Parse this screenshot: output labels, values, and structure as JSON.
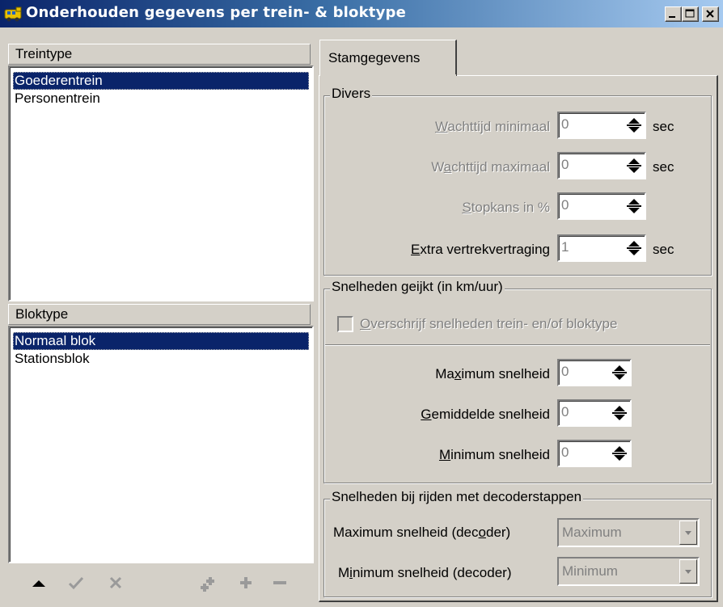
{
  "window": {
    "title": "Onderhouden gegevens per trein- & bloktype",
    "icon": "train-icon",
    "controls": [
      "minimize",
      "maximize",
      "close"
    ]
  },
  "treintype": {
    "header": "Treintype",
    "items": [
      "Goederentrein",
      "Personentrein"
    ],
    "selected": "Goederentrein"
  },
  "bloktype": {
    "header": "Bloktype",
    "items": [
      "Normaal blok",
      "Stationsblok"
    ],
    "selected": "Normaal blok"
  },
  "nav_buttons": [
    "move-up-icon",
    "confirm-icon",
    "cancel-icon",
    "add-multiple-icon",
    "add-icon",
    "remove-icon"
  ],
  "tabs": {
    "stamgegevens": "Stamgegevens"
  },
  "divers": {
    "legend": "Divers",
    "wachttijd_min": {
      "label_pre": "",
      "label_key": "W",
      "label_post": "achttijd minimaal",
      "value": "0",
      "unit": "sec"
    },
    "wachttijd_max": {
      "label_pre": "W",
      "label_key": "a",
      "label_post": "chttijd maximaal",
      "value": "0",
      "unit": "sec"
    },
    "stopkans": {
      "label_pre": "",
      "label_key": "S",
      "label_post": "topkans in %",
      "value": "0"
    },
    "extra_vertrek": {
      "label_pre": "",
      "label_key": "E",
      "label_post": "xtra vertrekvertraging",
      "value": "1",
      "unit": "sec"
    }
  },
  "snelheden": {
    "legend": "Snelheden geijkt (in km/uur)",
    "overschrijf": {
      "label_pre": "",
      "label_key": "O",
      "label_post": "verschrijf snelheden trein- en/of bloktype",
      "checked": false
    },
    "maximum": {
      "label_pre": "Ma",
      "label_key": "x",
      "label_post": "imum snelheid",
      "value": "0"
    },
    "gemiddelde": {
      "label_pre": "",
      "label_key": "G",
      "label_post": "emiddelde snelheid",
      "value": "0"
    },
    "minimum": {
      "label_pre": "",
      "label_key": "M",
      "label_post": "inimum snelheid",
      "value": "0"
    }
  },
  "decoder": {
    "legend": "Snelheden bij rijden met decoderstappen",
    "maximum": {
      "label_pre": "Maximum snelheid (dec",
      "label_key": "o",
      "label_post": "der)",
      "value": "Maximum"
    },
    "minimum": {
      "label_pre": "M",
      "label_key": "i",
      "label_post": "nimum snelheid (decoder)",
      "value": "Minimum"
    }
  },
  "colors": {
    "selection": "#0a246a",
    "face": "#d4d0c8",
    "disabled_text": "#808080"
  }
}
